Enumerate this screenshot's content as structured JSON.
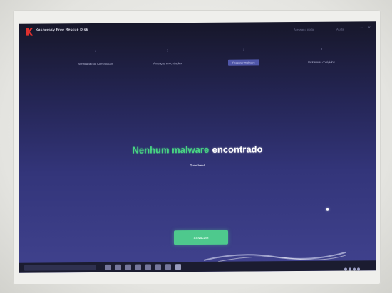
{
  "app": {
    "title": "Kaspersky Free Rescue Disk",
    "header_link_1": "Acessar o portal",
    "header_link_2": "Ajuda",
    "minimize_label": "—",
    "close_label": "✕"
  },
  "steps": [
    {
      "num": "1",
      "label": "Verificação do Computador"
    },
    {
      "num": "2",
      "label": "Ameaças encontradas"
    },
    {
      "num": "3",
      "label": "Procurar malware"
    },
    {
      "num": "4",
      "label": "Problemas corrigidos"
    }
  ],
  "result": {
    "prefix": "Nenhum malware",
    "suffix": "encontrado",
    "subtext": "Tudo bem!"
  },
  "done_button": "CONCLUIR",
  "colors": {
    "success_green": "#48d483",
    "button_green": "#4ec98d",
    "active_step": "#4f56a8",
    "logo_red": "#e0302e"
  }
}
